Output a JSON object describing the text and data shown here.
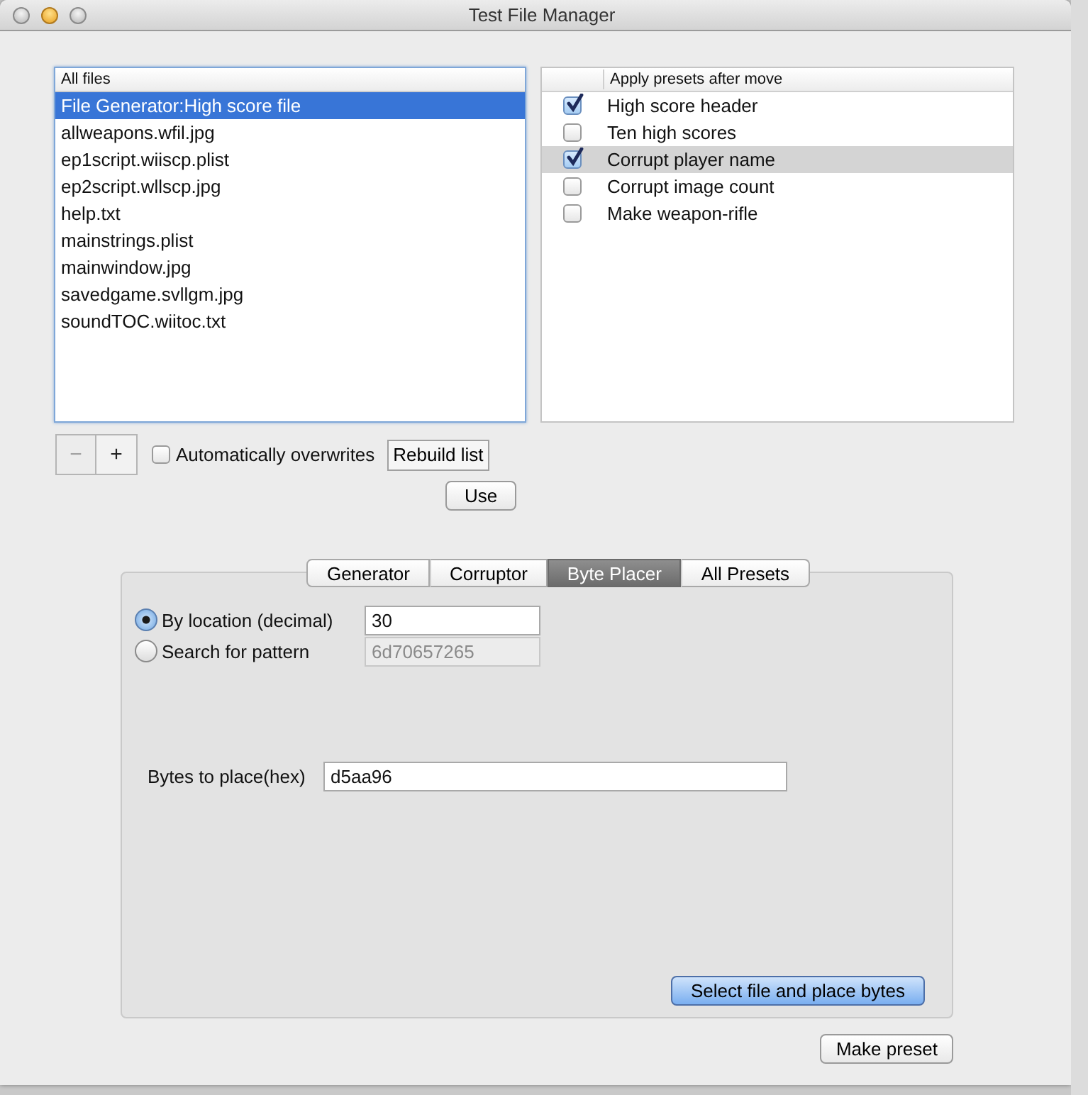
{
  "window": {
    "title": "Test File Manager"
  },
  "file_list": {
    "header": "All files",
    "items": [
      {
        "label": "File Generator:High score file",
        "selected": true
      },
      {
        "label": "allweapons.wfil.jpg",
        "selected": false
      },
      {
        "label": "ep1script.wiiscp.plist",
        "selected": false
      },
      {
        "label": "ep2script.wllscp.jpg",
        "selected": false
      },
      {
        "label": "help.txt",
        "selected": false
      },
      {
        "label": "mainstrings.plist",
        "selected": false
      },
      {
        "label": "mainwindow.jpg",
        "selected": false
      },
      {
        "label": "savedgame.svllgm.jpg",
        "selected": false
      },
      {
        "label": "soundTOC.wiitoc.txt",
        "selected": false
      }
    ]
  },
  "presets": {
    "header": "Apply presets after move",
    "items": [
      {
        "label": "High score header",
        "checked": true,
        "selected": false
      },
      {
        "label": "Ten high scores",
        "checked": false,
        "selected": false
      },
      {
        "label": "Corrupt player name",
        "checked": true,
        "selected": true
      },
      {
        "label": "Corrupt image count",
        "checked": false,
        "selected": false
      },
      {
        "label": "Make weapon-rifle",
        "checked": false,
        "selected": false
      }
    ]
  },
  "list_buttons": [
    {
      "label": "−",
      "disabled": true
    },
    {
      "label": "+",
      "disabled": false
    }
  ],
  "auto_overwrite": {
    "label": "Automatically overwrites",
    "checked": false
  },
  "rebuild_button": "Rebuild list",
  "use_button": "Use",
  "tabs": [
    {
      "label": "Generator",
      "selected": false
    },
    {
      "label": "Corruptor",
      "selected": false
    },
    {
      "label": "Byte Placer",
      "selected": true
    },
    {
      "label": "All Presets",
      "selected": false
    }
  ],
  "search_options": [
    {
      "label": "By location (decimal)",
      "selected": true,
      "value": "30",
      "disabled": false
    },
    {
      "label": "Search for pattern",
      "selected": false,
      "value": "6d70657265",
      "disabled": true
    }
  ],
  "bytes_field": {
    "label": "Bytes to place(hex)",
    "value": "d5aa96"
  },
  "place_button": "Select file and place bytes",
  "make_preset_button": "Make preset"
}
